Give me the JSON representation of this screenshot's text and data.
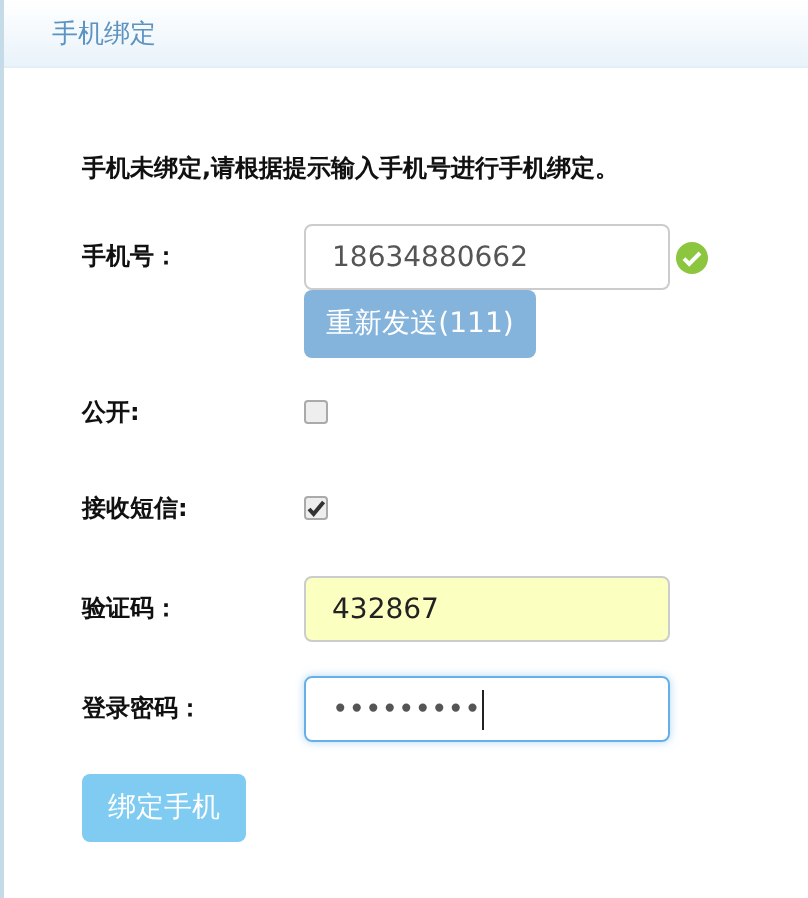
{
  "panel": {
    "title": "手机绑定"
  },
  "hint": "手机未绑定,请根据提示输入手机号进行手机绑定。",
  "rows": [
    {
      "kind": "input",
      "label": "手机号：",
      "value": "18634880662",
      "valid": true,
      "highlighted": false,
      "focused": false
    },
    {
      "kind": "button",
      "label_button": "重新发送(111)",
      "disabled": true
    },
    {
      "kind": "checkbox",
      "label": "公开:",
      "checked": false
    },
    {
      "kind": "checkbox",
      "label": "接收短信:",
      "checked": true
    },
    {
      "kind": "input",
      "label": "验证码：",
      "value": "432867",
      "valid": false,
      "highlighted": true,
      "focused": false
    },
    {
      "kind": "input",
      "label": "登录密码：",
      "value": "•••••••••",
      "valid": false,
      "highlighted": false,
      "focused": true
    }
  ],
  "submit": {
    "label": "绑定手机",
    "disabled": true
  }
}
